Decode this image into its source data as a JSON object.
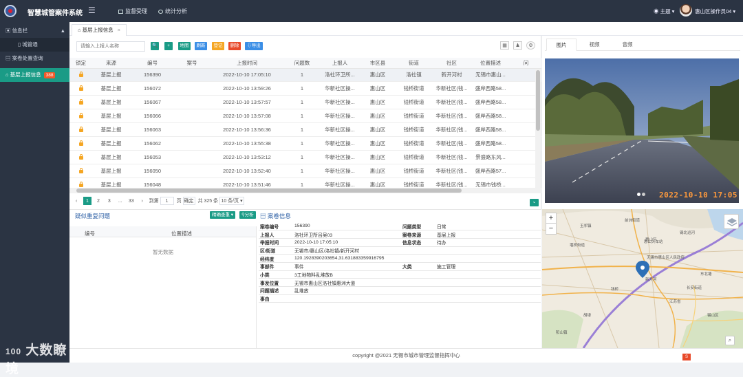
{
  "app": {
    "title": "智慧城管案件系统",
    "menu_toggle_icon": "☰"
  },
  "topnav": [
    {
      "label": "监督受理"
    },
    {
      "label": "统计分析"
    }
  ],
  "header_right": {
    "theme": "主题",
    "user": "惠山区操作员04"
  },
  "sidebar": {
    "items": [
      {
        "label": "信息栏",
        "caret": "▲"
      },
      {
        "label": "城管通"
      },
      {
        "label": "案卷处置查询"
      },
      {
        "label": "基层上报信息",
        "badge": "388"
      }
    ]
  },
  "watermark": {
    "text": "大数瞭境",
    "mark": "100"
  },
  "tabs": [
    {
      "label": "基层上报信息",
      "close": "×"
    }
  ],
  "toolbar": {
    "search_placeholder": "请输入上报人名称",
    "buttons": [
      {
        "label": "🔍",
        "color": "#1a9b86"
      },
      {
        "label": "+",
        "color": "#1a9b86"
      },
      {
        "label": "地图",
        "color": "#1a9b86"
      },
      {
        "label": "刷新",
        "color": "#3a8ee6"
      },
      {
        "label": "登记",
        "color": "#f5a623"
      },
      {
        "label": "删除",
        "color": "#e84a2a"
      },
      {
        "label": "导出",
        "color": "#3a8ee6"
      }
    ],
    "tool_icons": [
      "grid-icon",
      "user-icon",
      "settings-icon"
    ]
  },
  "table": {
    "columns": [
      "锁定",
      "来源",
      "编号",
      "案号",
      "上报时间",
      "问题数",
      "上报人",
      "市区县",
      "街道",
      "社区",
      "位置描述",
      "问"
    ],
    "rows": [
      [
        "",
        "基层上报",
        "156390",
        "",
        "2022-10-10 17:05:10",
        "1",
        "洛社环卫所...",
        "惠山区",
        "洛社镇",
        "新开河村",
        "无锡市惠山..."
      ],
      [
        "",
        "基层上报",
        "156072",
        "",
        "2022-10-10 13:59:26",
        "1",
        "华新社区操...",
        "惠山区",
        "钱桥街道",
        "华新社区(钱...",
        "盛岸西路58..."
      ],
      [
        "",
        "基层上报",
        "156067",
        "",
        "2022-10-10 13:57:57",
        "1",
        "华新社区操...",
        "惠山区",
        "钱桥街道",
        "华新社区(钱...",
        "盛岸西路58..."
      ],
      [
        "",
        "基层上报",
        "156066",
        "",
        "2022-10-10 13:57:08",
        "1",
        "华新社区操...",
        "惠山区",
        "钱桥街道",
        "华新社区(钱...",
        "盛岸西路58..."
      ],
      [
        "",
        "基层上报",
        "156063",
        "",
        "2022-10-10 13:56:36",
        "1",
        "华新社区操...",
        "惠山区",
        "钱桥街道",
        "华新社区(钱...",
        "盛岸西路58..."
      ],
      [
        "",
        "基层上报",
        "156062",
        "",
        "2022-10-10 13:55:38",
        "1",
        "华新社区操...",
        "惠山区",
        "钱桥街道",
        "华新社区(钱...",
        "盛岸西路58..."
      ],
      [
        "",
        "基层上报",
        "156053",
        "",
        "2022-10-10 13:53:12",
        "1",
        "华新社区操...",
        "惠山区",
        "钱桥街道",
        "华新社区(钱...",
        "景盛路东风..."
      ],
      [
        "",
        "基层上报",
        "156050",
        "",
        "2022-10-10 13:52:40",
        "1",
        "华新社区操...",
        "惠山区",
        "钱桥街道",
        "华新社区(钱...",
        "盛岸西路57..."
      ],
      [
        "",
        "基层上报",
        "156048",
        "",
        "2022-10-10 13:51:46",
        "1",
        "华新社区操...",
        "惠山区",
        "钱桥街道",
        "华新社区(钱...",
        "无锡市钱桥..."
      ]
    ]
  },
  "pager": {
    "prev": "‹",
    "pages": [
      "1",
      "2",
      "3",
      "...",
      "33"
    ],
    "next": "›",
    "goto_label": "到第",
    "goto_value": "1",
    "page_unit": "页",
    "confirm": "确定",
    "total": "共 325 条",
    "page_size": "10 条/页"
  },
  "right_tabs": [
    "图片",
    "视频",
    "音频"
  ],
  "photo": {
    "timestamp": "2022-10-10 17:05"
  },
  "duplicates": {
    "title": "疑似重复问题",
    "columns": [
      "编号",
      "位置描述"
    ],
    "empty": "暂无数据",
    "query_btn": "精确查重",
    "analyze_btn": "分析"
  },
  "case_info": {
    "title": "案卷信息",
    "rows": [
      [
        "案卷编号",
        "156390",
        "问题类型",
        "日常"
      ],
      [
        "上报人",
        "洛社环卫所吕吴03",
        "案卷来源",
        "基层上报"
      ],
      [
        "举报时间",
        "2022-10-10 17:05:10",
        "信息状态",
        "待办"
      ],
      [
        "区/街道",
        "无锡市/惠山区/洛社镇/新开河村",
        "",
        ""
      ],
      [
        "经纬度",
        "120.1928390203654,31.631883359916795",
        "",
        ""
      ],
      [
        "事部件",
        "事件",
        "大类",
        "施工管理"
      ],
      [
        "小类",
        "3工地物料乱堆放B",
        "",
        ""
      ],
      [
        "事发位置",
        "无锡市惠山区洛社镇惠洲大道",
        "",
        ""
      ],
      [
        "问题描述",
        "乱堆放",
        "",
        ""
      ],
      [
        "事由",
        "",
        "",
        ""
      ]
    ]
  },
  "map": {
    "labels": [
      "惠山区",
      "无锡市惠山区人民政府",
      "惠山火车站",
      "锡北运河",
      "堰桥街道",
      "新开河",
      "前洲街道",
      "玉祁镇",
      "钱桥",
      "东北塘",
      "江苏省",
      "锡山区",
      "长安街道",
      "胡埭",
      "阳山镇"
    ],
    "zoom_in": "+",
    "zoom_out": "−"
  },
  "footer": {
    "copyright": "copyright @2021 无锡市城市管理监督指挥中心",
    "lang": "S"
  }
}
